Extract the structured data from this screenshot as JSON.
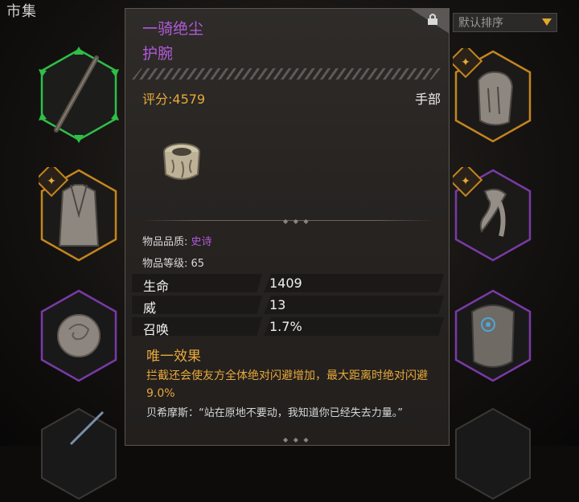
{
  "top_title": "市集",
  "sort": {
    "label": "默认排序"
  },
  "tooltip": {
    "item_name": "一骑绝尘",
    "item_type": "护腕",
    "score": "评分:4579",
    "slot": "手部",
    "quality_label": "物品品质: ",
    "quality_value": "史诗",
    "level": "物品等级: 65",
    "stats": [
      {
        "name": "生命",
        "value": "1409"
      },
      {
        "name": "威",
        "value": "13"
      },
      {
        "name": "召唤",
        "value": "1.7%"
      }
    ],
    "unique_title": "唯一效果",
    "unique_desc": "拦截还会使友方全体绝对闪避增加，最大距离时绝对闪避9.0%",
    "quote": "贝希摩斯：“站在原地不要动，我知道你已经失去力量。”"
  },
  "colors": {
    "epic": "#b15ad9",
    "gold": "#e8a93a",
    "equipped_green": "#2fbf48",
    "legendary_orange": "#c4851f",
    "epic_purple": "#7a3aa8"
  }
}
